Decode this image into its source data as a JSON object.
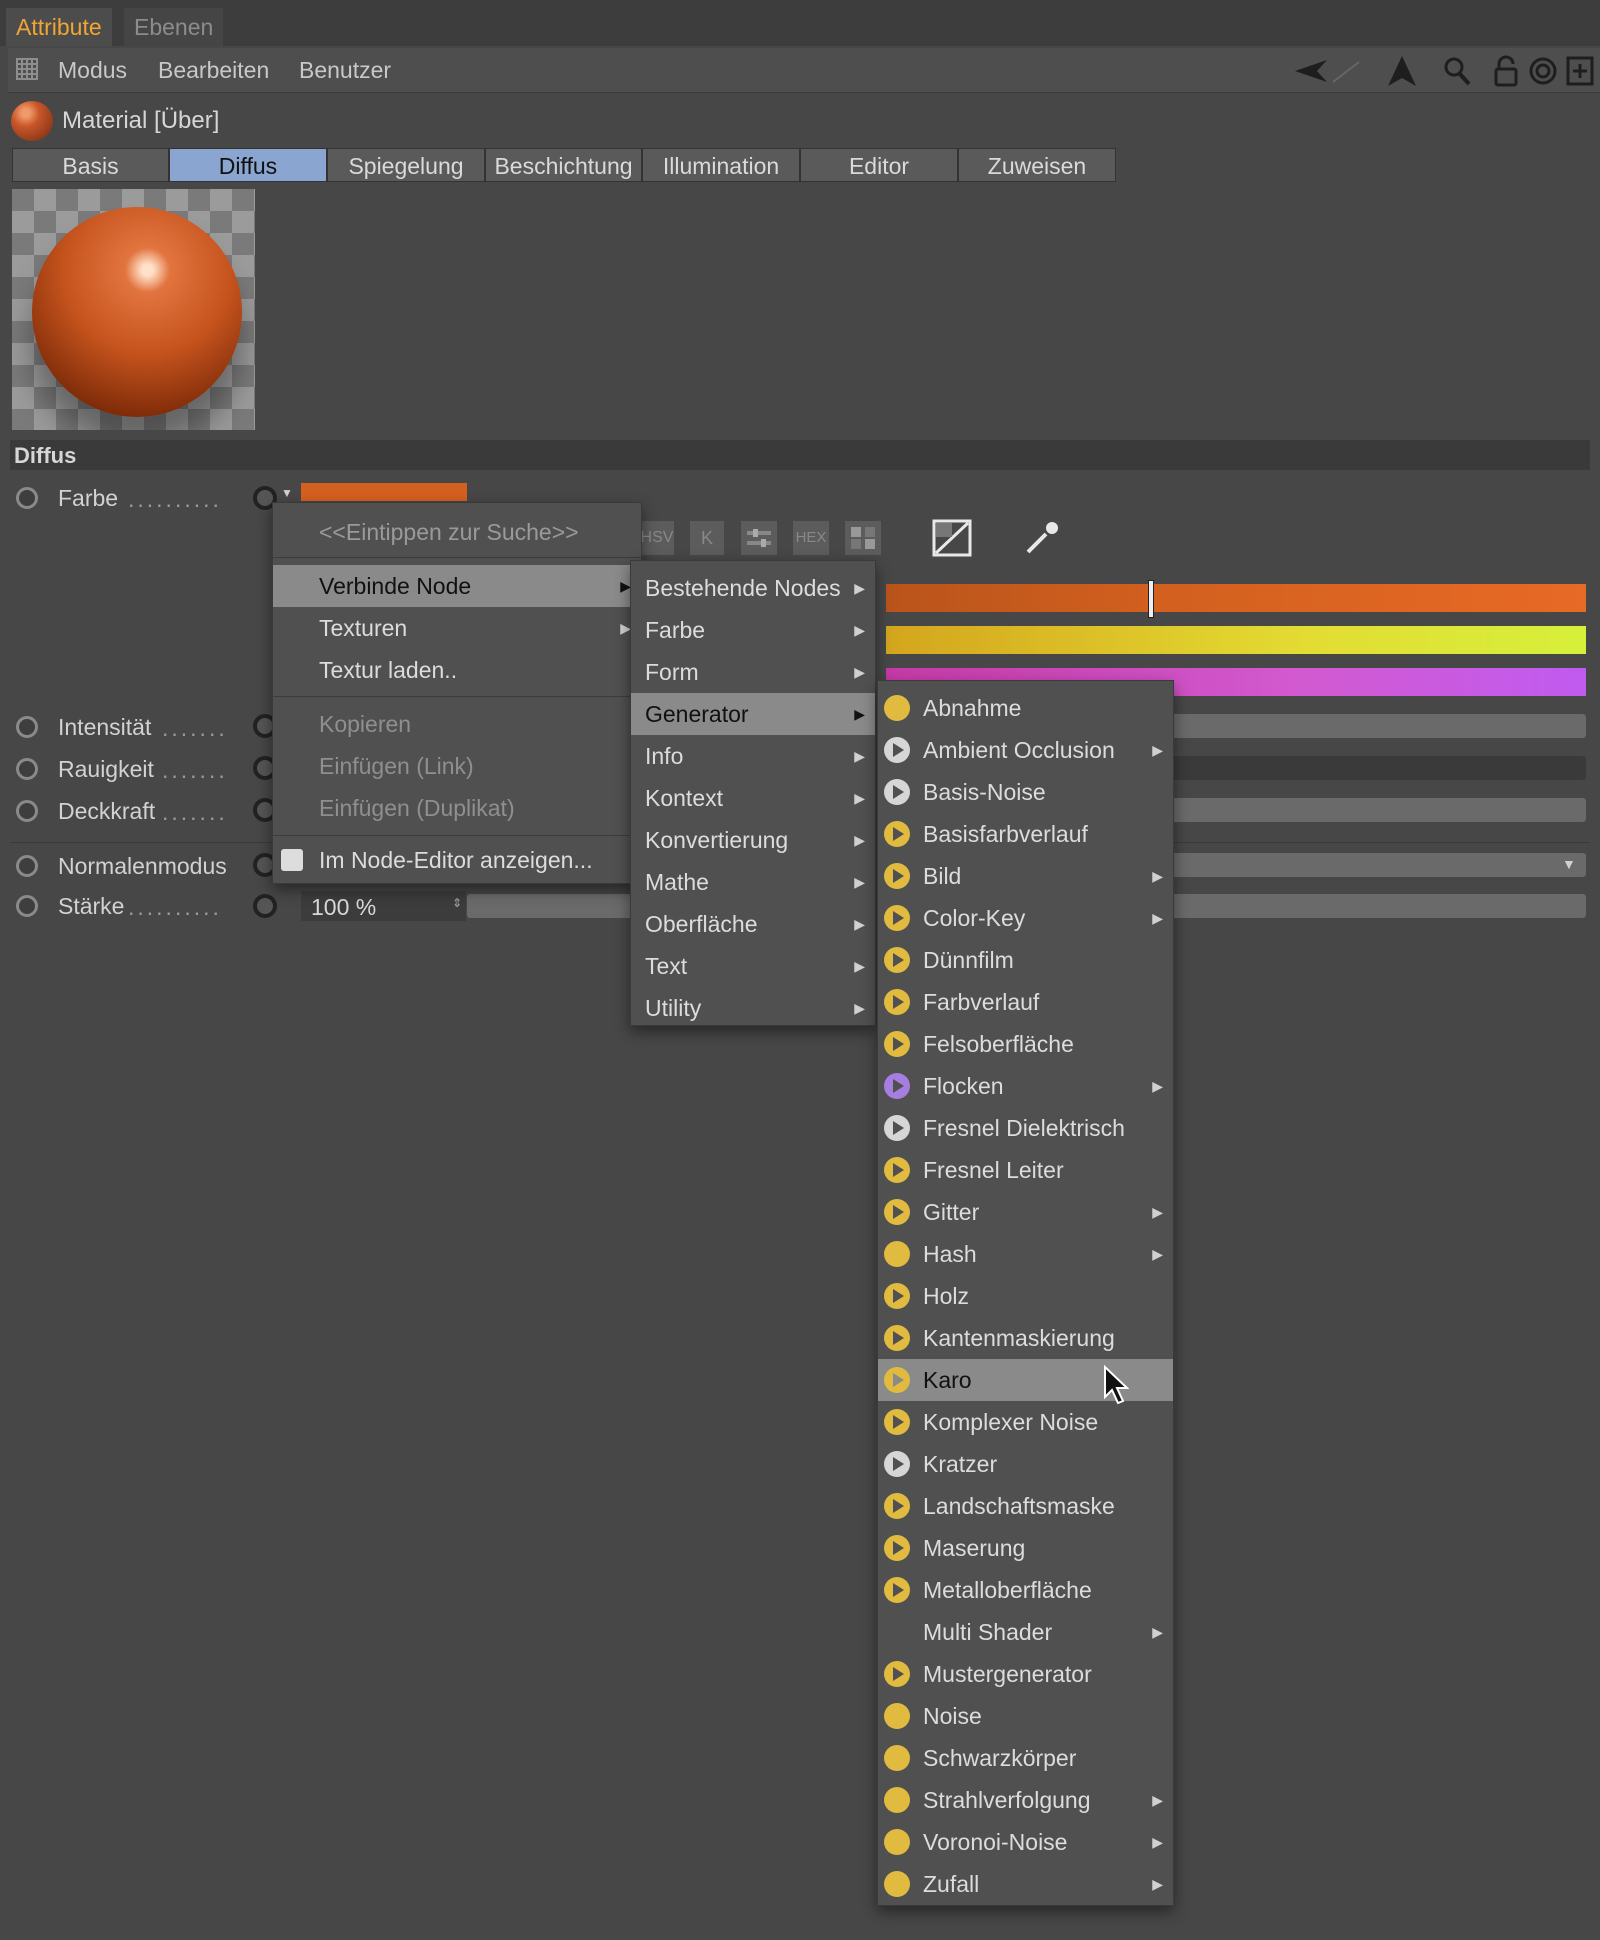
{
  "top_tabs": {
    "active": "Attribute",
    "inactive": "Ebenen"
  },
  "menubar": {
    "items": [
      "Modus",
      "Bearbeiten",
      "Benutzer"
    ]
  },
  "material": {
    "title": "Material [Über]"
  },
  "attr_tabs": [
    "Basis",
    "Diffus",
    "Spiegelung",
    "Beschichtung",
    "Illumination",
    "Editor",
    "Zuweisen"
  ],
  "selected_attr_tab": "Diffus",
  "section": {
    "title": "Diffus"
  },
  "params": {
    "farbe": "Farbe",
    "intensitaet": "Intensität",
    "rauigkeit": "Rauigkeit",
    "deckkraft": "Deckkraft",
    "normalenmodus": "Normalenmodus",
    "staerke": "Stärke",
    "staerke_value": "100 %"
  },
  "color_modes": [
    "HSV",
    "K",
    "HEX"
  ],
  "colors": {
    "accent_tab": "#f0a535",
    "selected_tab": "#8aa5cf",
    "swatch": "#d4601f"
  },
  "context_menu": {
    "search": "<<Eintippen zur Suche>>",
    "items": [
      {
        "label": "Verbinde Node",
        "submenu": true,
        "highlighted": true
      },
      {
        "label": "Texturen",
        "submenu": true
      },
      {
        "label": "Textur laden.."
      },
      {
        "label": "Kopieren",
        "disabled": true
      },
      {
        "label": "Einfügen (Link)",
        "disabled": true
      },
      {
        "label": "Einfügen (Duplikat)",
        "disabled": true
      },
      {
        "label": "Im Node-Editor anzeigen..."
      }
    ]
  },
  "submenu1": {
    "items": [
      "Bestehende Nodes",
      "Farbe",
      "Form",
      "Generator",
      "Info",
      "Kontext",
      "Konvertierung",
      "Mathe",
      "Oberfläche",
      "Text",
      "Utility"
    ],
    "highlighted": "Generator"
  },
  "submenu2": {
    "items": [
      {
        "label": "Abnahme",
        "icon": "yellow-dot"
      },
      {
        "label": "Ambient Occlusion",
        "icon": "white-play",
        "submenu": true
      },
      {
        "label": "Basis-Noise",
        "icon": "white-play"
      },
      {
        "label": "Basisfarbverlauf",
        "icon": "yellow-play"
      },
      {
        "label": "Bild",
        "icon": "yellow-play",
        "submenu": true
      },
      {
        "label": "Color-Key",
        "icon": "yellow-play",
        "submenu": true
      },
      {
        "label": "Dünnfilm",
        "icon": "yellow-play"
      },
      {
        "label": "Farbverlauf",
        "icon": "yellow-play"
      },
      {
        "label": "Felsoberfläche",
        "icon": "yellow-play"
      },
      {
        "label": "Flocken",
        "icon": "purple-play",
        "submenu": true
      },
      {
        "label": "Fresnel Dielektrisch",
        "icon": "white-play"
      },
      {
        "label": "Fresnel Leiter",
        "icon": "yellow-play"
      },
      {
        "label": "Gitter",
        "icon": "yellow-play",
        "submenu": true
      },
      {
        "label": "Hash",
        "icon": "yellow-dot",
        "submenu": true
      },
      {
        "label": "Holz",
        "icon": "yellow-play"
      },
      {
        "label": "Kantenmaskierung",
        "icon": "yellow-play"
      },
      {
        "label": "Karo",
        "icon": "yellow-play",
        "highlighted": true
      },
      {
        "label": "Komplexer Noise",
        "icon": "yellow-play"
      },
      {
        "label": "Kratzer",
        "icon": "white-play"
      },
      {
        "label": "Landschaftsmaske",
        "icon": "yellow-play"
      },
      {
        "label": "Maserung",
        "icon": "yellow-play"
      },
      {
        "label": "Metalloberfläche",
        "icon": "yellow-play"
      },
      {
        "label": "Multi Shader",
        "icon": "none",
        "submenu": true
      },
      {
        "label": "Mustergenerator",
        "icon": "yellow-play"
      },
      {
        "label": "Noise",
        "icon": "yellow-dot"
      },
      {
        "label": "Schwarzkörper",
        "icon": "yellow-dot"
      },
      {
        "label": "Strahlverfolgung",
        "icon": "yellow-dot",
        "submenu": true
      },
      {
        "label": "Voronoi-Noise",
        "icon": "yellow-dot",
        "submenu": true
      },
      {
        "label": "Zufall",
        "icon": "yellow-dot",
        "submenu": true
      }
    ]
  }
}
